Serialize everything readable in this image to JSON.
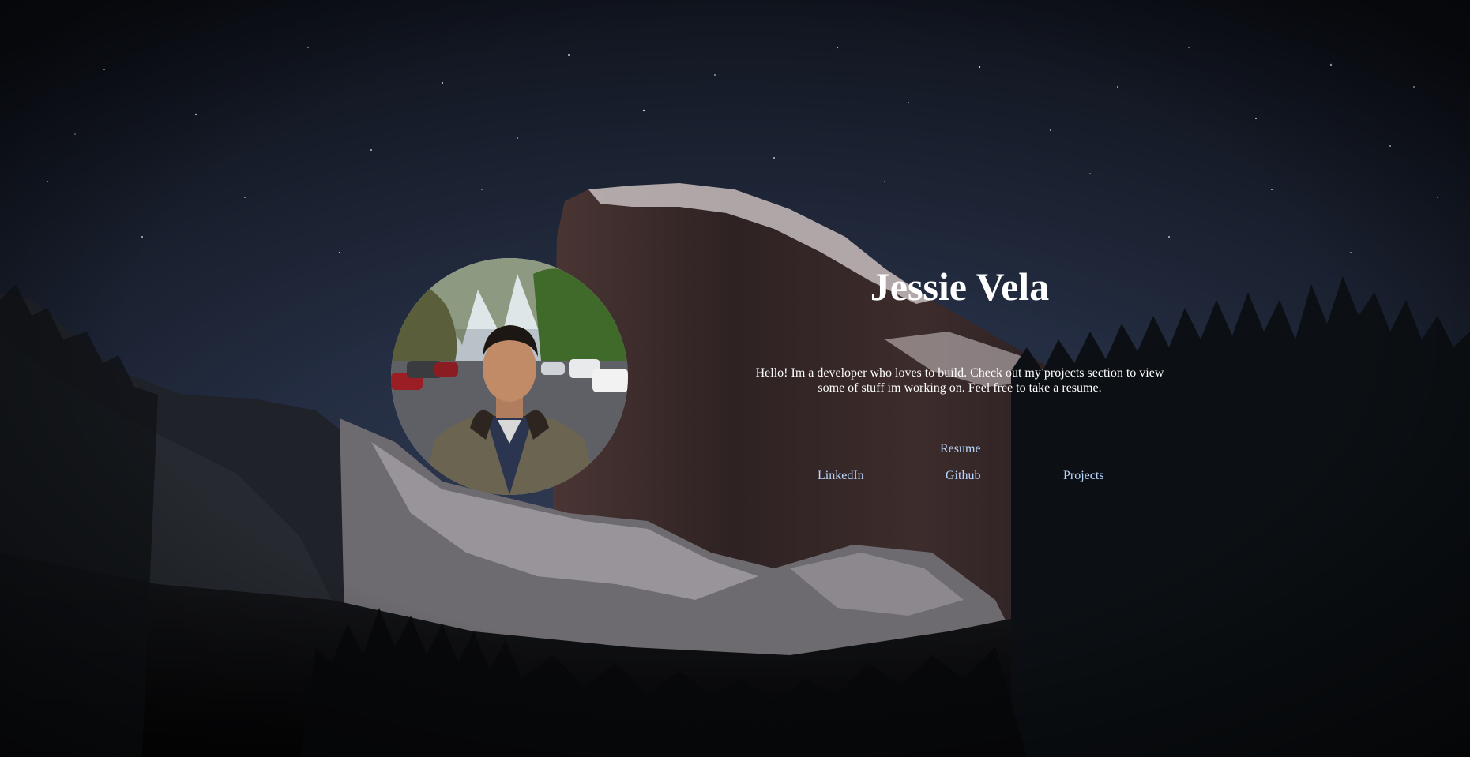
{
  "header": {
    "name": "Jessie Vela"
  },
  "intro": {
    "bio": "Hello! Im a developer who loves to build. Check out my projects section to view some of stuff im working on. Feel free to take a resume."
  },
  "links": {
    "resume": "Resume",
    "linkedin": "LinkedIn",
    "github": "Github",
    "projects": "Projects"
  },
  "colors": {
    "sky": "#1c2433",
    "heading": "#ffffff",
    "link": "#b9d6ff"
  }
}
